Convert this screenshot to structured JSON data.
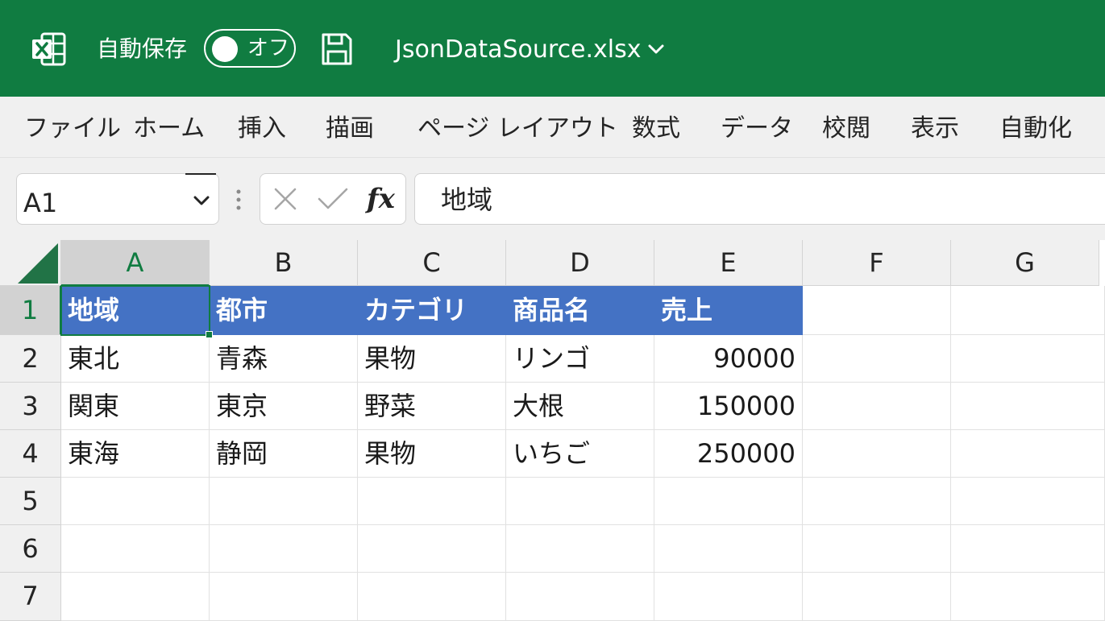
{
  "titlebar": {
    "autosave_label": "自動保存",
    "autosave_state": "オフ",
    "file_name": "JsonDataSource.xlsx",
    "background": "#107c41"
  },
  "ribbon": {
    "tabs": [
      "ファイル",
      "ホーム",
      "挿入",
      "描画",
      "ページ レイアウト",
      "数式",
      "データ",
      "校閲",
      "表示",
      "自動化"
    ]
  },
  "formula_bar": {
    "name_box": "A1",
    "formula": "地域",
    "fx_label": "fx"
  },
  "grid": {
    "columns": [
      "A",
      "B",
      "C",
      "D",
      "E",
      "F",
      "G"
    ],
    "rows": [
      "1",
      "2",
      "3",
      "4",
      "5",
      "6",
      "7"
    ],
    "active_cell": "A1",
    "header_fill": "#4472c4",
    "table": {
      "headers": [
        "地域",
        "都市",
        "カテゴリ",
        "商品名",
        "売上"
      ],
      "data": [
        [
          "東北",
          "青森",
          "果物",
          "リンゴ",
          "90000"
        ],
        [
          "関東",
          "東京",
          "野菜",
          "大根",
          "150000"
        ],
        [
          "東海",
          "静岡",
          "果物",
          "いちご",
          "250000"
        ]
      ]
    }
  }
}
